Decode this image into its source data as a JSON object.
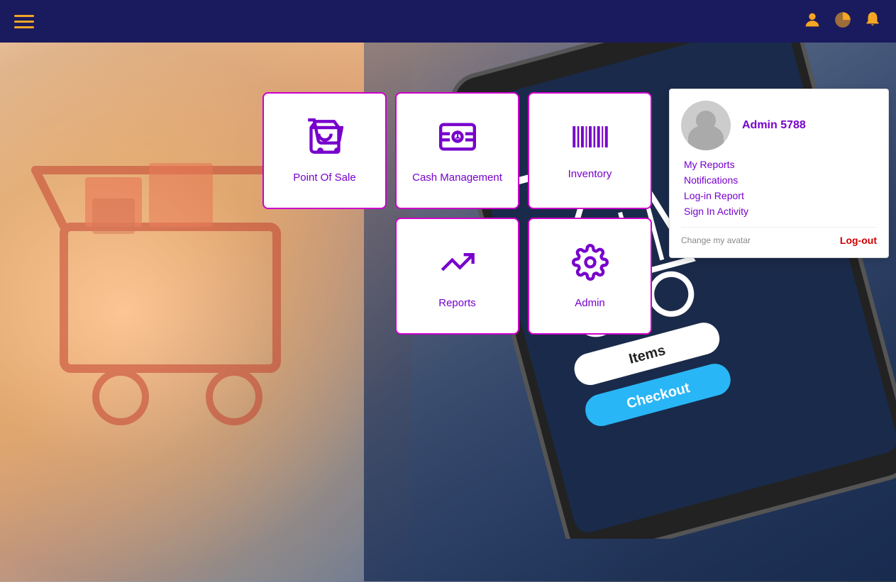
{
  "navbar": {
    "hamburger_label": "Menu",
    "icons": {
      "user": "👤",
      "pie": "📊",
      "bell": "🔔"
    }
  },
  "tiles": [
    {
      "id": "point-of-sale",
      "label": "Point Of Sale",
      "icon": "cart"
    },
    {
      "id": "cash-management",
      "label": "Cash Management",
      "icon": "cash"
    },
    {
      "id": "inventory",
      "label": "Inventory",
      "icon": "barcode"
    }
  ],
  "tiles_row2": [
    {
      "id": "reports",
      "label": "Reports",
      "icon": "chart"
    },
    {
      "id": "admin",
      "label": "Admin",
      "icon": "gear"
    }
  ],
  "dropdown": {
    "username": "Admin 5788",
    "links": [
      {
        "id": "my-reports",
        "label": "My Reports"
      },
      {
        "id": "notifications",
        "label": "Notifications"
      },
      {
        "id": "login-report",
        "label": "Log-in Report"
      },
      {
        "id": "sign-in-activity",
        "label": "Sign In Activity"
      }
    ],
    "change_avatar_label": "Change my avatar",
    "logout_label": "Log-out"
  }
}
